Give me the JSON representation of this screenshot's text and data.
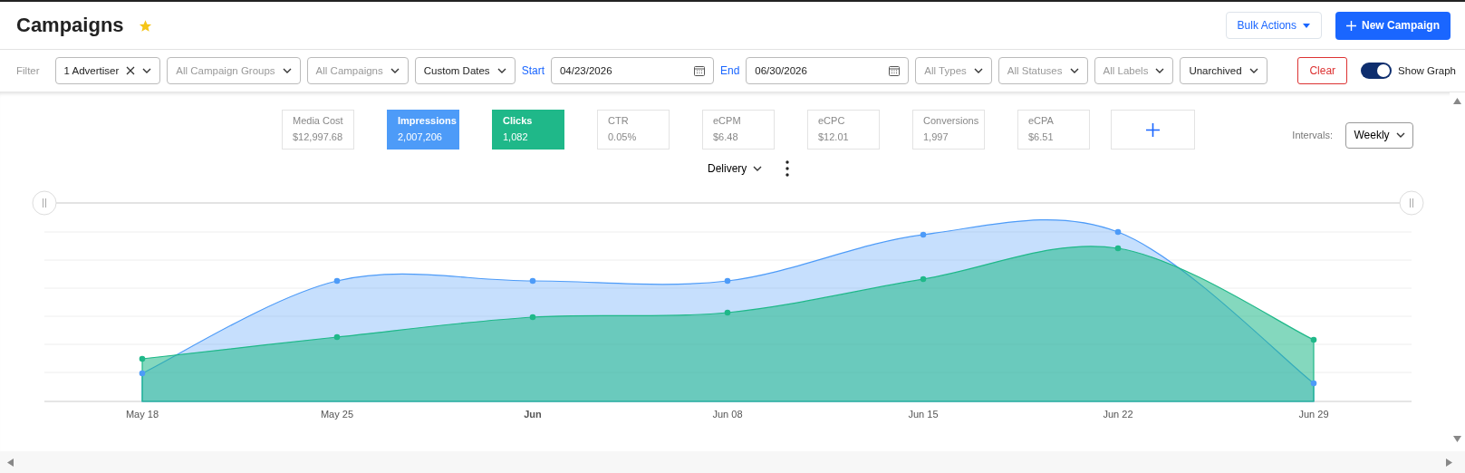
{
  "page": {
    "title": "Campaigns",
    "favorite": true
  },
  "actions": [
    {
      "kind": "menu",
      "label": "Bulk Actions"
    },
    {
      "kind": "primary",
      "label": "New Campaign"
    }
  ],
  "filter": {
    "label": "Filter",
    "controls": [
      {
        "kind": "select",
        "value": "1 Advertiser",
        "clearable": true
      },
      {
        "kind": "select",
        "placeholder": "All Campaign Groups"
      },
      {
        "kind": "select",
        "placeholder": "All Campaigns"
      },
      {
        "kind": "select",
        "value": "Custom Dates"
      },
      {
        "kind": "date",
        "label": "Start",
        "value": "04/23/2026"
      },
      {
        "kind": "date",
        "label": "End",
        "value": "06/30/2026"
      },
      {
        "kind": "select",
        "placeholder": "All Types"
      },
      {
        "kind": "select",
        "placeholder": "All Statuses"
      },
      {
        "kind": "select",
        "placeholder": "All Labels"
      },
      {
        "kind": "select",
        "value": "Unarchived"
      }
    ],
    "clear": "Clear",
    "show_graph": {
      "label": "Show Graph",
      "on": true
    }
  },
  "metrics": [
    {
      "label": "Media Cost",
      "value": "$12,997.68",
      "selected": false
    },
    {
      "label": "Impressions",
      "value": "2,007,206",
      "selected": true,
      "color": "#4d9bf8"
    },
    {
      "label": "Clicks",
      "value": "1,082",
      "selected": true,
      "color": "#1fb889"
    },
    {
      "label": "CTR",
      "value": "0.05%",
      "selected": false
    },
    {
      "label": "eCPM",
      "value": "$6.48",
      "selected": false
    },
    {
      "label": "eCPC",
      "value": "$12.01",
      "selected": false
    },
    {
      "label": "Conversions",
      "value": "1,997",
      "selected": false
    },
    {
      "label": "eCPA",
      "value": "$6.51",
      "selected": false
    }
  ],
  "intervals": {
    "label": "Intervals:",
    "value": "Weekly"
  },
  "view": {
    "value": "Delivery"
  },
  "x_labels": [
    {
      "label": "May 18",
      "bold": false
    },
    {
      "label": "May 25",
      "bold": false
    },
    {
      "label": "Jun",
      "bold": true
    },
    {
      "label": "Jun 08",
      "bold": false
    },
    {
      "label": "Jun 15",
      "bold": false
    },
    {
      "label": "Jun 22",
      "bold": false
    },
    {
      "label": "Jun 29",
      "bold": false
    }
  ]
}
